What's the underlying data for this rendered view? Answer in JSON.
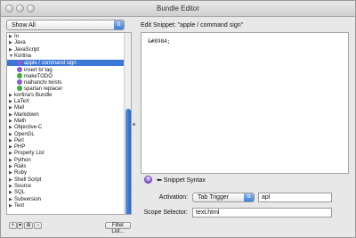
{
  "window": {
    "title": "Bundle Editor"
  },
  "filter": {
    "selected": "Show All"
  },
  "tree": {
    "items": [
      {
        "label": "Io",
        "expanded": false,
        "indent": 0,
        "icon": "bundle"
      },
      {
        "label": "Java",
        "expanded": false,
        "indent": 0,
        "icon": "bundle"
      },
      {
        "label": "JavaScript",
        "expanded": false,
        "indent": 0,
        "icon": "bundle"
      },
      {
        "label": "Kortina",
        "expanded": true,
        "indent": 0,
        "icon": "bundle"
      },
      {
        "label": "apple / command sign",
        "indent": 1,
        "icon": "snippet",
        "color": "#8a5cd8",
        "selected": true
      },
      {
        "label": "insert br tag",
        "indent": 1,
        "icon": "snippet",
        "color": "#8a5cd8"
      },
      {
        "label": "makeTODO",
        "indent": 1,
        "icon": "snippet",
        "color": "#3cae3c"
      },
      {
        "label": "naihanchi twists",
        "indent": 1,
        "icon": "snippet",
        "color": "#8a5cd8"
      },
      {
        "label": "spartan replacer",
        "indent": 1,
        "icon": "snippet",
        "color": "#3cae3c"
      },
      {
        "label": "kortina's Bundle",
        "expanded": false,
        "indent": 0,
        "icon": "bundle"
      },
      {
        "label": "LaTeX",
        "expanded": false,
        "indent": 0,
        "icon": "bundle"
      },
      {
        "label": "Mail",
        "expanded": false,
        "indent": 0,
        "icon": "bundle"
      },
      {
        "label": "Markdown",
        "expanded": false,
        "indent": 0,
        "icon": "bundle"
      },
      {
        "label": "Math",
        "expanded": false,
        "indent": 0,
        "icon": "bundle"
      },
      {
        "label": "Objective-C",
        "expanded": false,
        "indent": 0,
        "icon": "bundle"
      },
      {
        "label": "OpenGL",
        "expanded": false,
        "indent": 0,
        "icon": "bundle"
      },
      {
        "label": "Perl",
        "expanded": false,
        "indent": 0,
        "icon": "bundle"
      },
      {
        "label": "PHP",
        "expanded": false,
        "indent": 0,
        "icon": "bundle"
      },
      {
        "label": "Property List",
        "expanded": false,
        "indent": 0,
        "icon": "bundle"
      },
      {
        "label": "Python",
        "expanded": false,
        "indent": 0,
        "icon": "bundle"
      },
      {
        "label": "Rails",
        "expanded": false,
        "indent": 0,
        "icon": "bundle"
      },
      {
        "label": "Ruby",
        "expanded": false,
        "indent": 0,
        "icon": "bundle"
      },
      {
        "label": "Shell Script",
        "expanded": false,
        "indent": 0,
        "icon": "bundle"
      },
      {
        "label": "Source",
        "expanded": false,
        "indent": 0,
        "icon": "bundle"
      },
      {
        "label": "SQL",
        "expanded": false,
        "indent": 0,
        "icon": "bundle"
      },
      {
        "label": "Subversion",
        "expanded": false,
        "indent": 0,
        "icon": "bundle"
      },
      {
        "label": "Text",
        "expanded": false,
        "indent": 0,
        "icon": "bundle"
      }
    ]
  },
  "bottom_bar": {
    "add_label": "+",
    "add_menu_label": "▾",
    "action_label": "⊕",
    "remove_label": "−",
    "filter_list_label": "Filter List..."
  },
  "editor": {
    "heading": "Edit Snippet: \"apple / command sign\"",
    "content": "&#8984;"
  },
  "help": {
    "icon_glyph": "?",
    "link_label": "⬅ Snippet Syntax"
  },
  "activation": {
    "label": "Activation:",
    "selected": "Tab Trigger",
    "value": "apl"
  },
  "scope": {
    "label": "Scope Selector:",
    "value": "text.html"
  }
}
